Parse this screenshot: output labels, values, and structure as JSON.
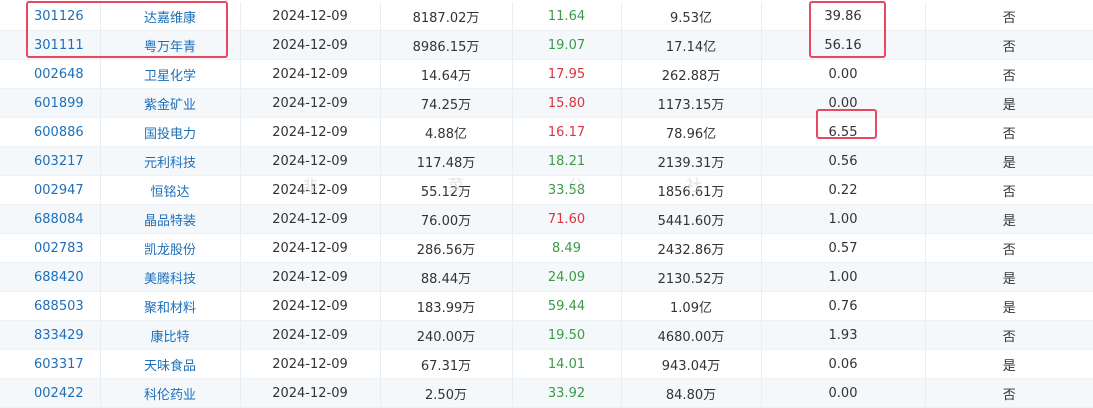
{
  "colors": {
    "link": "#1e6fb8",
    "green": "#3c9a48",
    "red": "#d9363e",
    "highlight": "#e8475f"
  },
  "watermark": [
    "韭",
    "菜",
    "公",
    "社"
  ],
  "rows": [
    {
      "code": "301126",
      "name": "达嘉维康",
      "date": "2024-12-09",
      "col4": "8187.02万",
      "col5": "11.64",
      "col5_color": "g",
      "col6": "9.53亿",
      "col7": "39.86",
      "col8": "否"
    },
    {
      "code": "301111",
      "name": "粤万年青",
      "date": "2024-12-09",
      "col4": "8986.15万",
      "col5": "19.07",
      "col5_color": "g",
      "col6": "17.14亿",
      "col7": "56.16",
      "col8": "否"
    },
    {
      "code": "002648",
      "name": "卫星化学",
      "date": "2024-12-09",
      "col4": "14.64万",
      "col5": "17.95",
      "col5_color": "r",
      "col6": "262.88万",
      "col7": "0.00",
      "col8": "否"
    },
    {
      "code": "601899",
      "name": "紫金矿业",
      "date": "2024-12-09",
      "col4": "74.25万",
      "col5": "15.80",
      "col5_color": "r",
      "col6": "1173.15万",
      "col7": "0.00",
      "col8": "是"
    },
    {
      "code": "600886",
      "name": "国投电力",
      "date": "2024-12-09",
      "col4": "4.88亿",
      "col5": "16.17",
      "col5_color": "r",
      "col6": "78.96亿",
      "col7": "6.55",
      "col8": "否"
    },
    {
      "code": "603217",
      "name": "元利科技",
      "date": "2024-12-09",
      "col4": "117.48万",
      "col5": "18.21",
      "col5_color": "g",
      "col6": "2139.31万",
      "col7": "0.56",
      "col8": "是"
    },
    {
      "code": "002947",
      "name": "恒铭达",
      "date": "2024-12-09",
      "col4": "55.12万",
      "col5": "33.58",
      "col5_color": "g",
      "col6": "1856.61万",
      "col7": "0.22",
      "col8": "否"
    },
    {
      "code": "688084",
      "name": "晶品特装",
      "date": "2024-12-09",
      "col4": "76.00万",
      "col5": "71.60",
      "col5_color": "r",
      "col6": "5441.60万",
      "col7": "1.00",
      "col8": "是"
    },
    {
      "code": "002783",
      "name": "凯龙股份",
      "date": "2024-12-09",
      "col4": "286.56万",
      "col5": "8.49",
      "col5_color": "g",
      "col6": "2432.86万",
      "col7": "0.57",
      "col8": "否"
    },
    {
      "code": "688420",
      "name": "美腾科技",
      "date": "2024-12-09",
      "col4": "88.44万",
      "col5": "24.09",
      "col5_color": "g",
      "col6": "2130.52万",
      "col7": "1.00",
      "col8": "是"
    },
    {
      "code": "688503",
      "name": "聚和材料",
      "date": "2024-12-09",
      "col4": "183.99万",
      "col5": "59.44",
      "col5_color": "g",
      "col6": "1.09亿",
      "col7": "0.76",
      "col8": "是"
    },
    {
      "code": "833429",
      "name": "康比特",
      "date": "2024-12-09",
      "col4": "240.00万",
      "col5": "19.50",
      "col5_color": "g",
      "col6": "4680.00万",
      "col7": "1.93",
      "col8": "否"
    },
    {
      "code": "603317",
      "name": "天味食品",
      "date": "2024-12-09",
      "col4": "67.31万",
      "col5": "14.01",
      "col5_color": "g",
      "col6": "943.04万",
      "col7": "0.06",
      "col8": "是"
    },
    {
      "code": "002422",
      "name": "科伦药业",
      "date": "2024-12-09",
      "col4": "2.50万",
      "col5": "33.92",
      "col5_color": "g",
      "col6": "84.80万",
      "col7": "0.00",
      "col8": "否"
    }
  ]
}
